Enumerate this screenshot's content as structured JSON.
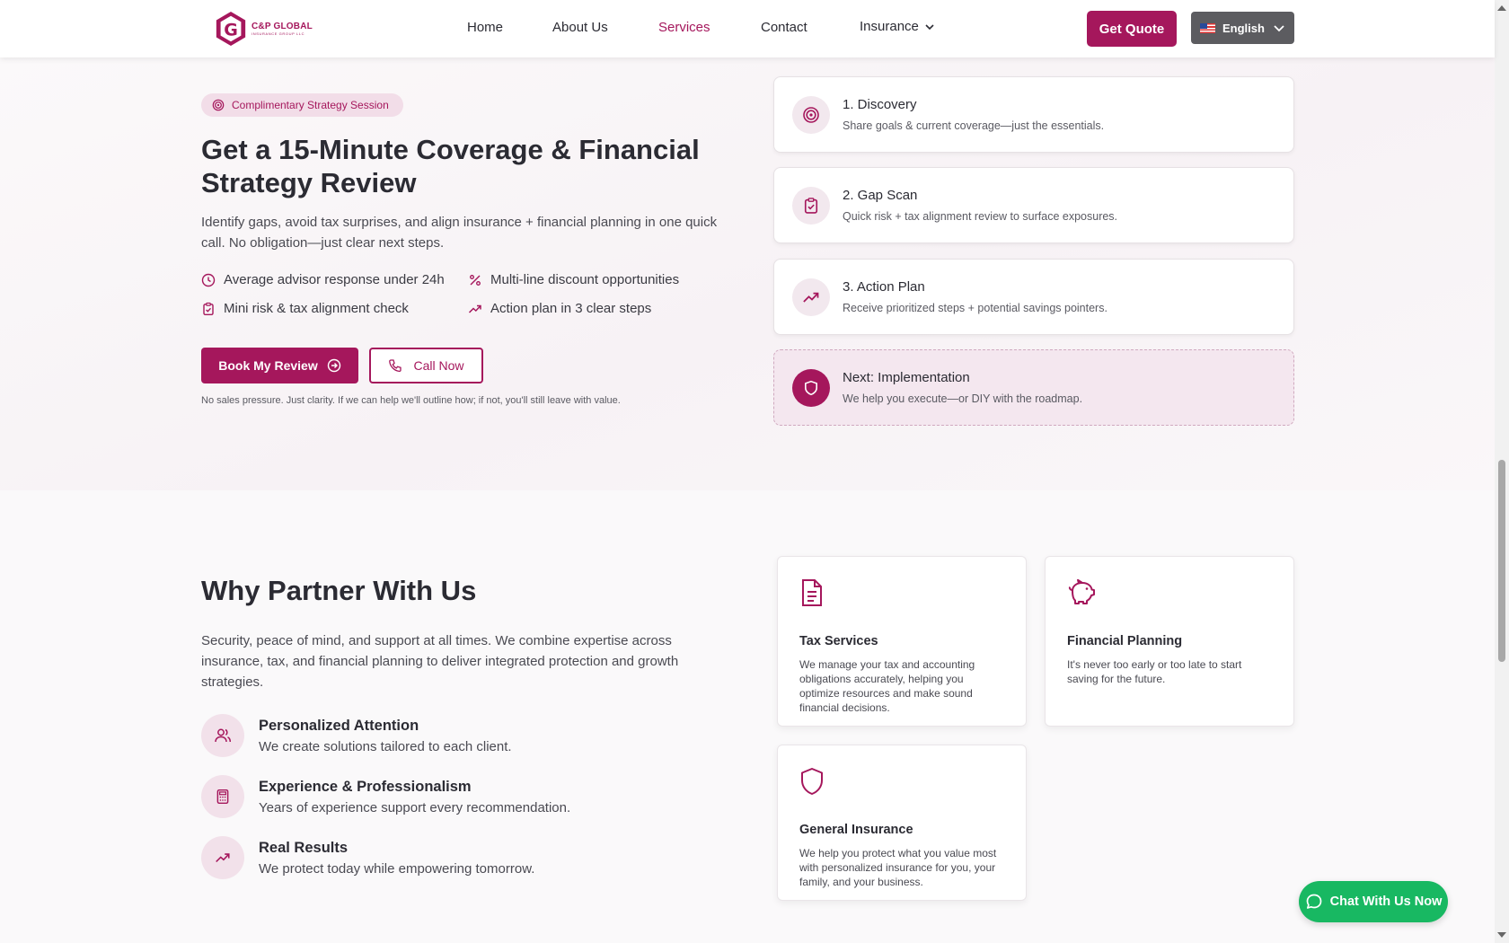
{
  "header": {
    "logo": {
      "title": "C&P GLOBAL",
      "subtitle": "INSURANCE GROUP LLC"
    },
    "nav": [
      {
        "label": "Home"
      },
      {
        "label": "About Us"
      },
      {
        "label": "Services",
        "active": true
      },
      {
        "label": "Contact"
      },
      {
        "label": "Insurance",
        "dropdown": true
      }
    ],
    "quote_button": "Get Quote",
    "language": {
      "selected": "English",
      "flag": "us-flag"
    }
  },
  "hero": {
    "badge": "Complimentary Strategy Session",
    "title": "Get a 15-Minute Coverage & Financial Strategy Review",
    "description": "Identify gaps, avoid tax surprises, and align insurance + financial planning in one quick call. No obligation—just clear next steps.",
    "features": [
      {
        "icon": "clock-icon",
        "text": "Average advisor response under 24h"
      },
      {
        "icon": "percent-icon",
        "text": "Multi-line discount opportunities"
      },
      {
        "icon": "clipboard-check-icon",
        "text": "Mini risk & tax alignment check"
      },
      {
        "icon": "trending-up-icon",
        "text": "Action plan in 3 clear steps"
      }
    ],
    "book_button": "Book My Review",
    "call_button": "Call Now",
    "note": "No sales pressure. Just clarity. If we can help we'll outline how; if not, you'll still leave with value."
  },
  "steps": [
    {
      "icon": "target-icon",
      "title": "1. Discovery",
      "desc": "Share goals & current coverage—just the essentials."
    },
    {
      "icon": "clipboard-check-icon",
      "title": "2. Gap Scan",
      "desc": "Quick risk + tax alignment review to surface exposures."
    },
    {
      "icon": "trending-up-icon",
      "title": "3. Action Plan",
      "desc": "Receive prioritized steps + potential savings pointers."
    },
    {
      "icon": "shield-icon",
      "title": "Next: Implementation",
      "desc": "We help you execute—or DIY with the roadmap."
    }
  ],
  "partner": {
    "title": "Why Partner With Us",
    "description": "Security, peace of mind, and support at all times. We combine expertise across insurance, tax, and financial planning to deliver integrated protection and growth strategies.",
    "benefits": [
      {
        "icon": "users-icon",
        "title": "Personalized Attention",
        "desc": "We create solutions tailored to each client."
      },
      {
        "icon": "calculator-icon",
        "title": "Experience & Professionalism",
        "desc": "Years of experience support every recommendation."
      },
      {
        "icon": "trending-up-icon",
        "title": "Real Results",
        "desc": "We protect today while empowering tomorrow."
      }
    ],
    "services": [
      {
        "icon": "document-icon",
        "title": "Tax Services",
        "desc": "We manage your tax and accounting obligations accurately, helping you optimize resources and make sound financial decisions."
      },
      {
        "icon": "piggy-bank-icon",
        "title": "Financial Planning",
        "desc": "It's never too early or too late to start saving for the future."
      },
      {
        "icon": "shield-icon",
        "title": "General Insurance",
        "desc": "We help you protect what you value most with personalized insurance for you, your family, and your business."
      }
    ]
  },
  "chat_button": "Chat With Us Now",
  "colors": {
    "brand": "#a5175c",
    "chat": "#18b862",
    "text": "#2b2b33"
  }
}
